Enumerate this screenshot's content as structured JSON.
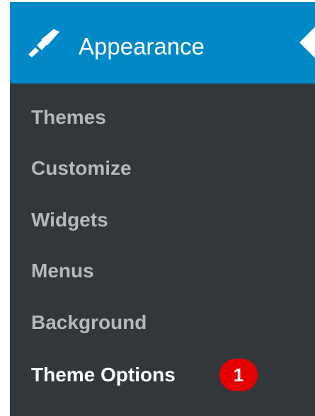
{
  "menu": {
    "header": {
      "label": "Appearance",
      "icon": "paintbrush-icon"
    },
    "items": [
      {
        "label": "Themes",
        "current": false
      },
      {
        "label": "Customize",
        "current": false
      },
      {
        "label": "Widgets",
        "current": false
      },
      {
        "label": "Menus",
        "current": false
      },
      {
        "label": "Background",
        "current": false
      },
      {
        "label": "Theme Options",
        "current": true
      }
    ],
    "badge": "1"
  },
  "colors": {
    "menu_background": "#32373c",
    "header_background": "#0088c7",
    "item_text": "#b4b9be",
    "current_item_text": "#ffffff",
    "badge_background": "#e60000"
  }
}
